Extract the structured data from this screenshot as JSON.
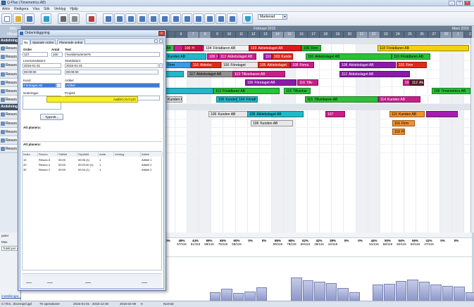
{
  "window": {
    "title": "Q-Plan (Timemetrics AB)"
  },
  "menu": [
    "Arkiv",
    "Redigera",
    "Visa",
    "Sök",
    "Verktyg",
    "Hjälp"
  ],
  "toolbar": {
    "buttons": [
      "new-icon",
      "open-icon",
      "save-icon",
      "undo-icon",
      "print-icon",
      "print-preview-icon",
      "calendar-icon",
      "view-day-icon",
      "view-week-icon",
      "view-month-icon",
      "view-list-icon",
      "view-gantt-icon",
      "view-chart-icon",
      "view-table-icon",
      "view-grid-icon",
      "view-split-icon",
      "view-res-icon",
      "view-load-icon",
      "filter-icon"
    ],
    "combo_value": "Markerad"
  },
  "left_header": {
    "title": "Mån",
    "sub": "Månad"
  },
  "timeline": {
    "months": [
      {
        "label": "Februari 2015"
      },
      {
        "label": "Mars 2015"
      }
    ],
    "days": [
      "6",
      "7",
      "8",
      "9",
      "10",
      "11",
      "12",
      "13",
      "14",
      "15",
      "16",
      "17",
      "18",
      "19",
      "20",
      "21",
      "22",
      "23",
      "24",
      "25",
      "26",
      "27",
      "28",
      "1",
      "2"
    ],
    "weekend_days": [
      "7",
      "8",
      "14",
      "15",
      "21",
      "22",
      "28",
      "1"
    ]
  },
  "resources": {
    "groups": [
      {
        "label": "Avdelning"
      },
      {
        "label": "Avdelning"
      }
    ],
    "items": [
      "Resurs",
      "Resurs",
      "Resurs",
      "Resurs",
      "Resurs",
      "Resurs",
      "Resurs",
      "Resurs",
      "Resurs",
      "Resurs",
      "Resurs",
      "Resurs"
    ]
  },
  "gantt": {
    "bars": [
      {
        "id": "AB",
        "name": "",
        "color": "#31c540",
        "row": 0
      },
      {
        "id": "",
        "name": "",
        "color": "#d41e8e",
        "row": 0
      },
      {
        "id": "100",
        "name": "H",
        "color": "#c2123a",
        "row": 0
      },
      {
        "id": "104",
        "name": "Förädlaren AB",
        "color": "#f2f2f2",
        "row": 0
      },
      {
        "id": "103",
        "name": "Aktiebolaget AB",
        "color": "#e01818",
        "row": 0
      },
      {
        "id": "100",
        "name": "Firm",
        "color": "#21b52a",
        "row": 0
      },
      {
        "id": "118",
        "name": "Förädlaren AB",
        "color": "#f2d20a",
        "row": 0
      },
      {
        "id": "",
        "name": "Kunden AB",
        "color": "#22b8c8",
        "row": 1
      },
      {
        "id": "100",
        "name": "Före",
        "color": "#d41e8e",
        "row": 1
      },
      {
        "id": "112",
        "name": "Aktiebolaget AB",
        "color": "#c81e8a",
        "row": 1
      },
      {
        "id": "110",
        "name": "Firma",
        "color": "#a61eb0",
        "row": 1
      },
      {
        "id": "103",
        "name": "Kunde",
        "color": "#e02a1a",
        "row": 1
      },
      {
        "id": "116",
        "name": "Aktiebolaget AB",
        "color": "#2ac03a",
        "row": 1
      },
      {
        "id": "116",
        "name": "Förädlaren AB",
        "color": "#2ac03a",
        "row": 1
      },
      {
        "id": "",
        "name": "Firm",
        "color": "#3a9ae8",
        "row": 2
      },
      {
        "id": "116",
        "name": "Aktiebo",
        "color": "#e02a1a",
        "row": 2
      },
      {
        "id": "100",
        "name": "Företaget",
        "color": "#e8e8e8",
        "row": 2
      },
      {
        "id": "105",
        "name": "Aktiebolaget",
        "color": "#e02a1a",
        "row": 2
      },
      {
        "id": "108",
        "name": "Firma",
        "color": "#c81e8a",
        "row": 2
      },
      {
        "id": "108",
        "name": "Aktiebolaget AB",
        "color": "#8a1aa8",
        "row": 2
      },
      {
        "id": "101",
        "name": "Firm",
        "color": "#e02a1a",
        "row": 2
      },
      {
        "id": "",
        "name": "",
        "color": "#22b8c8",
        "row": 3
      },
      {
        "id": "117",
        "name": "Aktiebolaget AB",
        "color": "#909090",
        "row": 3
      },
      {
        "id": "113",
        "name": "Tillverkaren AB",
        "color": "#c81e8a",
        "row": 3
      },
      {
        "id": "112",
        "name": "Aktiebolaget AB",
        "color": "#8a1aa8",
        "row": 3
      },
      {
        "id": "100",
        "name": "Företaget AB",
        "color": "#8a1aa8",
        "row": 4
      },
      {
        "id": "116",
        "name": "Tillv",
        "color": "#c81e8a",
        "row": 4
      },
      {
        "id": "101",
        "name": "",
        "color": "#c81e8a",
        "row": 4
      },
      {
        "id": "112",
        "name": "AM",
        "color": "#5a1a28",
        "row": 4
      },
      {
        "id": "",
        "name": "",
        "color": "#22b8c8",
        "row": 5
      },
      {
        "id": "113",
        "name": "Förädlaren AB",
        "color": "#2ac03a",
        "row": 5
      },
      {
        "id": "115",
        "name": "Tillverkar",
        "color": "#2ac03a",
        "row": 5
      },
      {
        "id": "108",
        "name": "Timemetrics AB",
        "color": "#2ac03a",
        "row": 5
      },
      {
        "id": "",
        "name": "Kunden AB",
        "color": "#d8d8d8",
        "row": 6
      },
      {
        "id": "105",
        "name": "Kunden AB",
        "color": "#22b8c8",
        "row": 6
      },
      {
        "id": "104",
        "name": "Förädl",
        "color": "#22b8c8",
        "row": 6
      },
      {
        "id": "115",
        "name": "Tillverkaren AB",
        "color": "#2ac03a",
        "row": 6
      },
      {
        "id": "114",
        "name": "Kunden AB",
        "color": "#c81e8a",
        "row": 6
      },
      {
        "id": "106",
        "name": "Kunden AB",
        "color": "#e8e8e8",
        "row": 7
      },
      {
        "id": "105",
        "name": "Aktiebolaget AB",
        "color": "#22b8c8",
        "row": 7
      },
      {
        "id": "107",
        "name": "",
        "color": "#c81e8a",
        "row": 7
      },
      {
        "id": "115",
        "name": "Kunden AB",
        "color": "#f0902a",
        "row": 7
      },
      {
        "id": "",
        "name": "",
        "color": "#a61eb0",
        "row": 7
      },
      {
        "id": "106",
        "name": "Kunden AB",
        "color": "#e8e8e8",
        "row": 8
      },
      {
        "id": "116",
        "name": "Firm",
        "color": "#f0902a",
        "row": 8
      },
      {
        "id": "116",
        "name": "FG",
        "color": "#f0902a",
        "row": 9
      }
    ]
  },
  "stats": {
    "percentages": [
      {
        "pct": "0%",
        "sub": ""
      },
      {
        "pct": "0%",
        "sub": ""
      },
      {
        "pct": "49%",
        "sub": "57/115"
      },
      {
        "pct": "44%",
        "sub": "51/115"
      },
      {
        "pct": "59%",
        "sub": "68/115"
      },
      {
        "pct": "65%",
        "sub": "75/115"
      },
      {
        "pct": "60%",
        "sub": "69/115"
      },
      {
        "pct": "0%",
        "sub": ""
      },
      {
        "pct": "0%",
        "sub": ""
      },
      {
        "pct": "86%",
        "sub": "99/115"
      },
      {
        "pct": "68%",
        "sub": "78/115"
      },
      {
        "pct": "52%",
        "sub": "60/115"
      },
      {
        "pct": "42%",
        "sub": "48/115"
      },
      {
        "pct": "38%",
        "sub": "44/115"
      },
      {
        "pct": "0%",
        "sub": ""
      },
      {
        "pct": "0%",
        "sub": ""
      },
      {
        "pct": "44%",
        "sub": "51/115"
      },
      {
        "pct": "50%",
        "sub": "58/115"
      },
      {
        "pct": "54%",
        "sub": "62/115"
      },
      {
        "pct": "56%",
        "sub": "64/115"
      },
      {
        "pct": "41%",
        "sub": "47/115"
      },
      {
        "pct": "0%",
        "sub": ""
      },
      {
        "pct": "0%",
        "sub": ""
      }
    ],
    "histogram": [
      0,
      0,
      0,
      0.2,
      0.28,
      0.18,
      0.22,
      0.32,
      0,
      0,
      0.55,
      0.48,
      0.45,
      0.42,
      0.3,
      0.2,
      0,
      0.38,
      0.4,
      0.47,
      0.5,
      0.45,
      0.38,
      0.35,
      0.34,
      0.2,
      0.1
    ]
  },
  "bottom_left": {
    "label1": "peter",
    "label2": "Max",
    "label3": "Totalt per dag",
    "label4": "Inställningar..."
  },
  "statusbar": [
    "C:\\Tim...\\Exempel.qpl",
    "70 operationer",
    "2015-01-01 - 2015-12-30",
    "2015-02-09",
    "0",
    "Normal"
  ],
  "dialog": {
    "title": "Orderinläggning",
    "tabs": [
      "Ny",
      "Sparade ordrar",
      "Planerade ordrar"
    ],
    "labels": {
      "order": "Order",
      "antal": "Antal",
      "text": "Text",
      "leverans": "Leveransdatum:",
      "start": "Startdatum:",
      "kund": "Kund",
      "artikel": "Artikel",
      "notering": "Noteringar:",
      "projekt": "Projekt:",
      "planerat": "Att planera:"
    },
    "fields": {
      "order": "127",
      "antal": "100",
      "text": "%ordernummer%",
      "lev_date": "2015-01-31",
      "lev_time": "00:00:00",
      "start_date": "2015-01-31",
      "start_time": "00:00:00",
      "kund": "Företaget AB",
      "artikel": "Artikel"
    },
    "button": "Typsnitt...",
    "yellow_text": "AaBbCcXxYyZz",
    "table": {
      "headers": [
        "Index",
        "Resurs",
        "Ställtid",
        "Styckttid",
        "Antal",
        "Verktyg",
        "Artikel"
      ],
      "rows": [
        [
          "10",
          "Resurs 5",
          "00:00",
          "00:06 (1)",
          "1",
          "",
          "Artikel 1"
        ],
        [
          "20",
          "Resurs 4",
          "00:00",
          "00:03:30 (1)",
          "1",
          "",
          "Artikel 2"
        ],
        [
          "30",
          "Resurs 2",
          "00:00",
          "00:04 (1)",
          "1",
          "",
          "Artikel 2"
        ]
      ]
    }
  }
}
